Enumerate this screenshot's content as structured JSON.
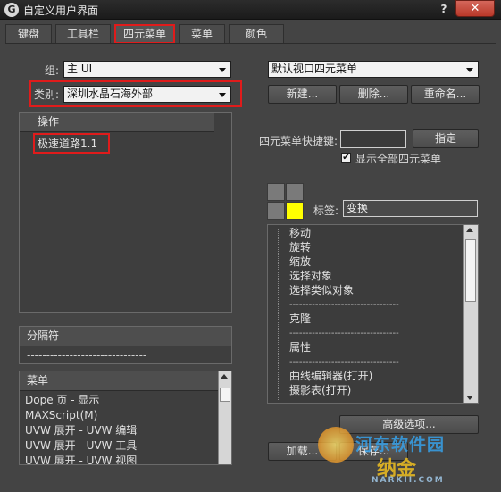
{
  "window": {
    "title": "自定义用户界面",
    "help_label": "?",
    "close_label": "✕",
    "app_icon_label": "G"
  },
  "tabs": [
    {
      "label": "键盘",
      "active": false
    },
    {
      "label": "工具栏",
      "active": false
    },
    {
      "label": "四元菜单",
      "active": true
    },
    {
      "label": "菜单",
      "active": false
    },
    {
      "label": "颜色",
      "active": false
    }
  ],
  "left": {
    "group_label": "组:",
    "group_value": "主 UI",
    "category_label": "类别:",
    "category_value": "深圳水晶石海外部",
    "actions": {
      "header": "操作",
      "items": [
        "极速道路1.1"
      ]
    },
    "separator": {
      "header": "分隔符",
      "item": "-------------------------------"
    },
    "menus": {
      "header": "菜单",
      "items": [
        "Dope 页 - 显示",
        "MAXScript(M)",
        "UVW 展开 - UVW 编辑",
        "UVW 展开 - UVW 工具",
        "UVW 展开 - UVW 视图"
      ]
    }
  },
  "right": {
    "quad_select_value": "默认视口四元菜单",
    "buttons": {
      "new": "新建...",
      "delete": "删除...",
      "rename": "重命名..."
    },
    "shortcut": {
      "label": "四元菜单快捷键:",
      "value": "",
      "assign": "指定"
    },
    "show_all": {
      "label": "显示全部四元菜单",
      "checked": true
    },
    "tag": {
      "label": "标签:",
      "value": "变换"
    },
    "quad_colors": {
      "top_left": "#7a7a7a",
      "top_right": "#7a7a7a",
      "bottom_left": "#7a7a7a",
      "bottom_right": "#ffff00"
    },
    "menu_items": [
      "移动",
      "旋转",
      "缩放",
      "选择对象",
      "选择类似对象",
      "----------------------------------",
      "克隆",
      "----------------------------------",
      "属性",
      "----------------------------------",
      "曲线编辑器(打开)",
      "摄影表(打开)"
    ],
    "advanced_button": "高级选项...",
    "load_button": "加载...",
    "save_button": "保存..."
  },
  "watermark": {
    "top": "河东软件园",
    "middle": "纳金",
    "bottom": "NARKII.COM"
  }
}
